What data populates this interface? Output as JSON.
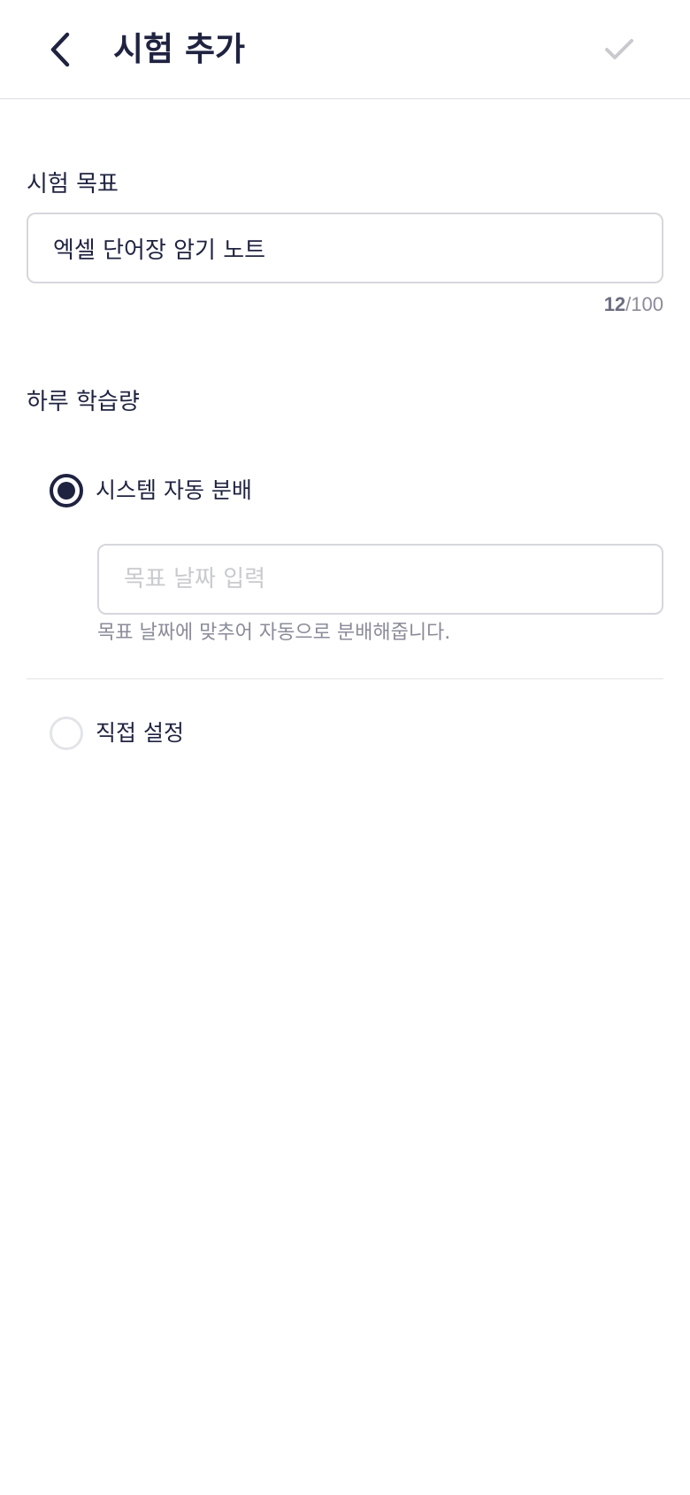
{
  "header": {
    "title": "시험 추가"
  },
  "goal": {
    "label": "시험 목표",
    "value": "엑셀 단어장 암기 노트",
    "count_current": "12",
    "count_max": "/100"
  },
  "daily": {
    "label": "하루 학습량",
    "options": [
      {
        "label": "시스템 자동 분배",
        "selected": true
      },
      {
        "label": "직접 설정",
        "selected": false
      }
    ],
    "date_input": {
      "placeholder": "목표 날짜 입력",
      "value": ""
    },
    "helper": "목표 날짜에 맞추어 자동으로 분배해줍니다."
  },
  "colors": {
    "primary": "#1f2340",
    "disabled": "#c9cace",
    "border": "#d6d7dc",
    "muted": "#8a8c99"
  },
  "icons": {
    "back": "chevron-left-icon",
    "confirm": "check-icon"
  }
}
